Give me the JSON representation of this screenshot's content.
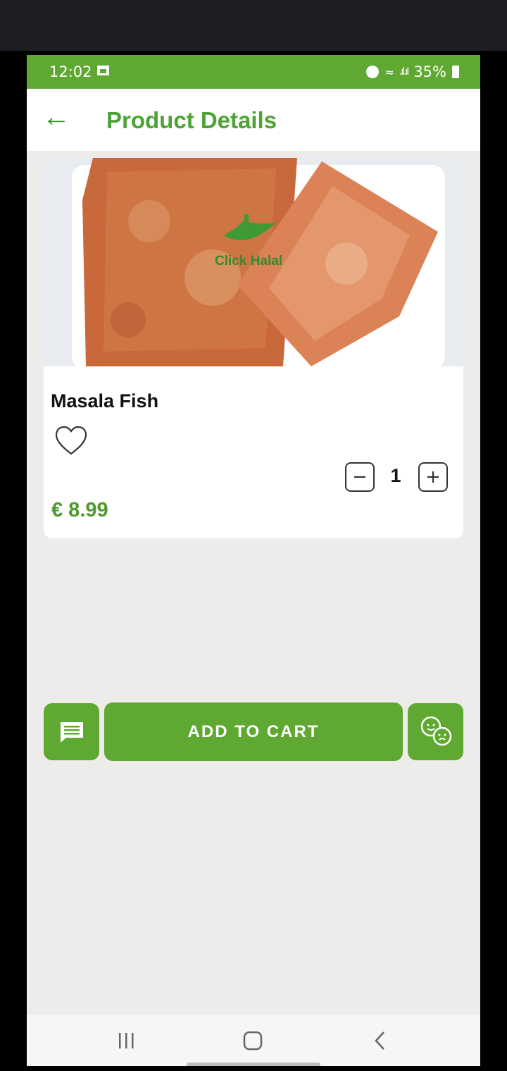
{
  "status_bar": {
    "time": "12:02",
    "battery": "35%"
  },
  "app_bar": {
    "title": "Product Details"
  },
  "product": {
    "image_watermark": "Click Halal",
    "name": "Masala Fish",
    "quantity": "1",
    "price": "€ 8.99"
  },
  "actions": {
    "add_to_cart_label": "ADD TO CART"
  },
  "colors": {
    "accent_green": "#5fa832",
    "price_green": "#4e9a2f",
    "background": "#eeebeb"
  },
  "icons": [
    "back-arrow-icon",
    "heart-icon",
    "minus-icon",
    "plus-icon",
    "message-icon",
    "chat-faces-icon",
    "nav-recent-icon",
    "nav-home-icon",
    "nav-back-icon"
  ]
}
